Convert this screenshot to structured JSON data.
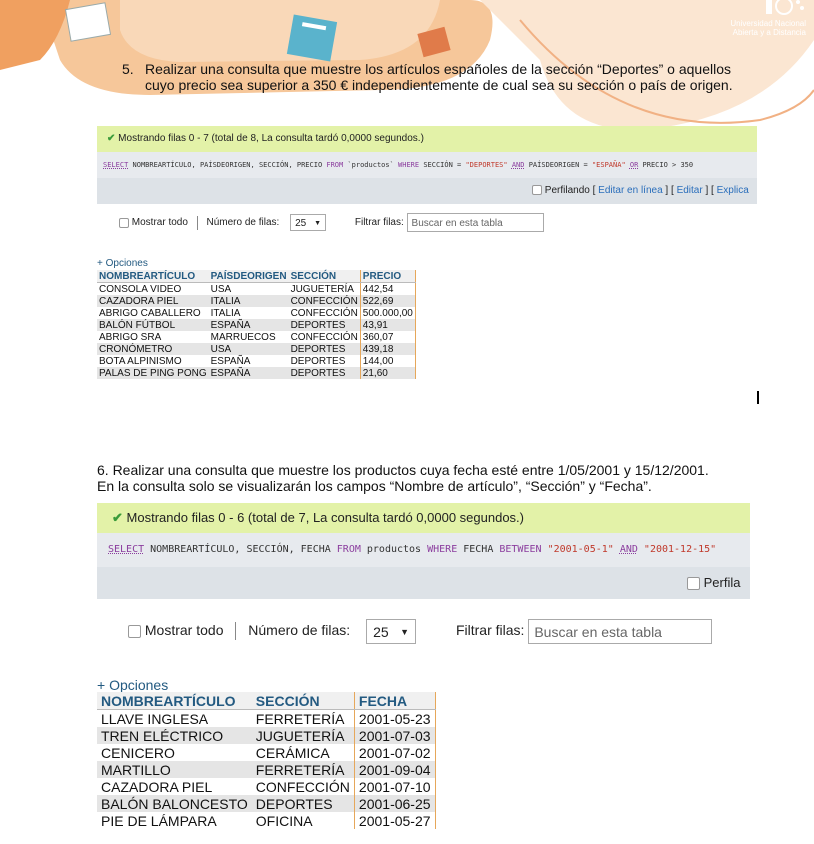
{
  "header": {
    "logo_line1": "Universidad Nacional",
    "logo_line2": "Abierta y a Distancia"
  },
  "question5": {
    "number": "5.",
    "line1": "Realizar una consulta que muestre los artículos españoles de la sección “Deportes” o aquellos",
    "line2": "cuyo precio sea superior a 350 € independientemente de cual sea su sección o país de origen."
  },
  "panel1": {
    "success_text": "Mostrando filas 0 - 7 (total de 8, La consulta tardó 0,0000 segundos.)",
    "sql": {
      "select": "SELECT",
      "fields": " NOMBREARTÍCULO, PAÍSDEORIGEN, SECCIÓN, PRECIO ",
      "from": "FROM",
      "table": " `productos` ",
      "where": "WHERE",
      "cond1": " SECCIÓN = ",
      "val1": "\"DEPORTES\"",
      "and": "AND",
      "cond2": " PAÍSDEORIGEN = ",
      "val2": "\"ESPAÑA\"",
      "or": "OR",
      "cond3": " PRECIO > 350"
    },
    "profiling_label": "Perfilando",
    "edit_inline": "Editar en línea",
    "edit": "Editar",
    "explain": "Explica",
    "show_all": "Mostrar todo",
    "num_rows_label": "Número de filas:",
    "num_rows_value": "25",
    "filter_label": "Filtrar filas:",
    "filter_placeholder": "Buscar en esta tabla",
    "options": "+ Opciones",
    "columns": [
      "NOMBREARTÍCULO",
      "PAÍSDEORIGEN",
      "SECCIÓN",
      "PRECIO"
    ],
    "rows": [
      [
        "CONSOLA VIDEO",
        "USA",
        "JUGUETERÍA",
        "442,54"
      ],
      [
        "CAZADORA PIEL",
        "ITALIA",
        "CONFECCIÓN",
        "522,69"
      ],
      [
        "ABRIGO CABALLERO",
        "ITALIA",
        "CONFECCIÓN",
        "500.000,00"
      ],
      [
        "BALÓN FÚTBOL",
        "ESPAÑA",
        "DEPORTES",
        "43,91"
      ],
      [
        "ABRIGO SRA",
        "MARRUECOS",
        "CONFECCIÓN",
        "360,07"
      ],
      [
        "CRONÓMETRO",
        "USA",
        "DEPORTES",
        "439,18"
      ],
      [
        "BOTA ALPINISMO",
        "ESPAÑA",
        "DEPORTES",
        "144,00"
      ],
      [
        "PALAS DE PING PONG",
        "ESPAÑA",
        "DEPORTES",
        "21,60"
      ]
    ]
  },
  "question6": {
    "line1": "6. Realizar una consulta que muestre los productos cuya fecha esté entre 1/05/2001 y 15/12/2001.",
    "line2": "En la consulta solo se visualizarán los campos “Nombre de artículo”, “Sección” y “Fecha”."
  },
  "panel2": {
    "success_text": "Mostrando filas 0 - 6 (total de 7, La consulta tardó 0,0000 segundos.)",
    "sql": {
      "select": "SELECT",
      "fields": " NOMBREARTÍCULO, SECCIÓN, FECHA ",
      "from": "FROM",
      "table": " productos ",
      "where": "WHERE",
      "cond": " FECHA ",
      "between": "BETWEEN",
      "val1": "\"2001-05-1\"",
      "and": "AND",
      "val2": "\"2001-12-15\""
    },
    "profiling_label": "Perfila",
    "show_all": "Mostrar todo",
    "num_rows_label": "Número de filas:",
    "num_rows_value": "25",
    "filter_label": "Filtrar filas:",
    "filter_placeholder": "Buscar en esta tabla",
    "options": "+ Opciones",
    "columns": [
      "NOMBREARTÍCULO",
      "SECCIÓN",
      "FECHA"
    ],
    "rows": [
      [
        "LLAVE INGLESA",
        "FERRETERÍA",
        "2001-05-23"
      ],
      [
        "TREN ELÉCTRICO",
        "JUGUETERÍA",
        "2001-07-03"
      ],
      [
        "CENICERO",
        "CERÁMICA",
        "2001-07-02"
      ],
      [
        "MARTILLO",
        "FERRETERÍA",
        "2001-09-04"
      ],
      [
        "CAZADORA PIEL",
        "CONFECCIÓN",
        "2001-07-10"
      ],
      [
        "BALÓN BALONCESTO",
        "DEPORTES",
        "2001-06-25"
      ],
      [
        "PIE DE LÁMPARA",
        "OFICINA",
        "2001-05-27"
      ]
    ]
  }
}
